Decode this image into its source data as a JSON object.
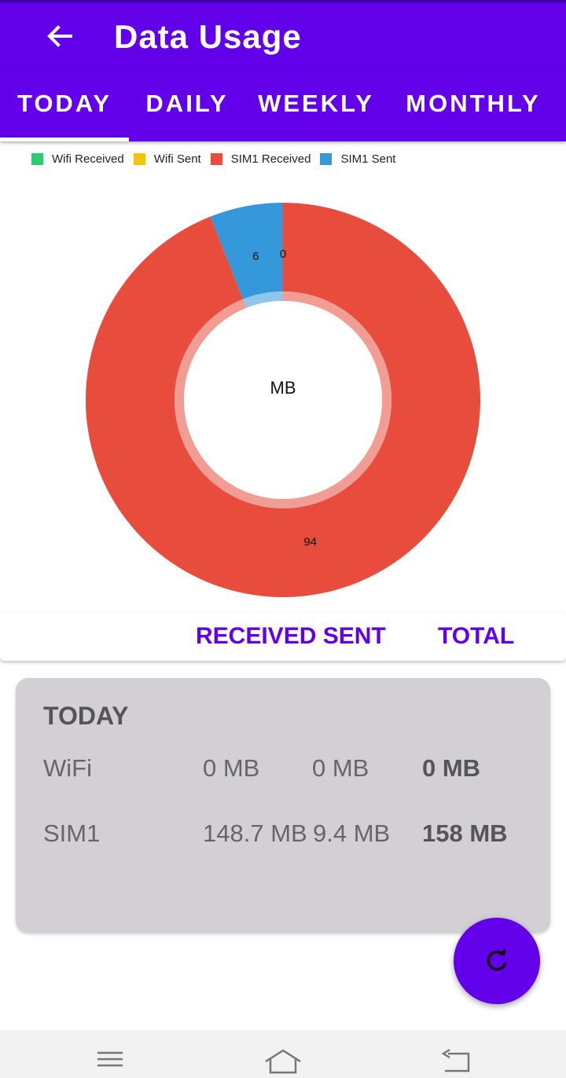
{
  "header": {
    "title": "Data Usage"
  },
  "tabs": [
    {
      "label": "TODAY",
      "selected": true
    },
    {
      "label": "DAILY",
      "selected": false
    },
    {
      "label": "WEEKLY",
      "selected": false
    },
    {
      "label": "MONTHLY",
      "selected": false
    }
  ],
  "legend": [
    {
      "label": "Wifi Received",
      "color": "#2ecc71"
    },
    {
      "label": "Wifi Sent",
      "color": "#f1c40f"
    },
    {
      "label": "SIM1 Received",
      "color": "#e74c3c"
    },
    {
      "label": "SIM1 Sent",
      "color": "#3498db"
    }
  ],
  "chart_data": {
    "type": "pie",
    "center_label": "MB",
    "slices": [
      {
        "label": "Wifi Received",
        "value": 0,
        "color": "#2ecc71",
        "value_label": "0"
      },
      {
        "label": "Wifi Sent",
        "value": 0,
        "color": "#f1c40f",
        "value_label": ""
      },
      {
        "label": "SIM1 Received",
        "value": 94,
        "color": "#e74c3c",
        "value_label": "94"
      },
      {
        "label": "SIM1 Sent",
        "value": 6,
        "color": "#3498db",
        "value_label": "6"
      }
    ]
  },
  "columns": {
    "received_sent": "RECEIVED SENT",
    "total": "TOTAL"
  },
  "summary": {
    "period_title": "TODAY",
    "rows": [
      {
        "name": "WiFi",
        "received": "0 MB",
        "sent": "0 MB",
        "total": "0 MB"
      },
      {
        "name": "SIM1",
        "received": "148.7 MB",
        "sent": "9.4 MB",
        "total": "158 MB"
      }
    ]
  },
  "fab": {
    "icon": "refresh-icon"
  },
  "navbar": {
    "icons": [
      "menu-icon",
      "home-icon",
      "back-nav-icon"
    ]
  }
}
